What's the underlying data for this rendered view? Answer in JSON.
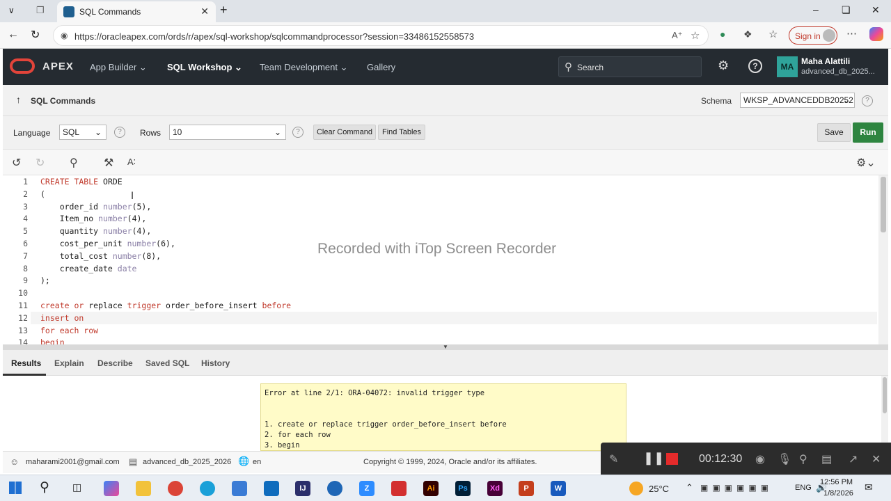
{
  "browser": {
    "tab_title": "SQL Commands",
    "url": "https://oracleapex.com/ords/r/apex/sql-workshop/sqlcommandprocessor?session=33486152558573",
    "signin_label": "Sign in"
  },
  "apex": {
    "brand": "APEX",
    "nav": [
      "App Builder",
      "SQL Workshop",
      "Team Development",
      "Gallery"
    ],
    "search_placeholder": "Search",
    "user_initials": "MA",
    "user_name": "Maha Alattili",
    "user_workspace": "advanced_db_2025..."
  },
  "page": {
    "title": "SQL Commands",
    "schema_label": "Schema",
    "schema_value": "WKSP_ADVANCEDDB20252"
  },
  "toolbar": {
    "language_label": "Language",
    "language_value": "SQL",
    "rows_label": "Rows",
    "rows_value": "10",
    "clear_label": "Clear Command",
    "find_label": "Find Tables",
    "save_label": "Save",
    "run_label": "Run"
  },
  "editor": {
    "lines": [
      {
        "n": "1",
        "parts": [
          {
            "t": "CREATE TABLE ",
            "c": "kw"
          },
          {
            "t": "ORDE",
            "c": ""
          }
        ]
      },
      {
        "n": "2",
        "parts": [
          {
            "t": "(",
            "c": ""
          }
        ]
      },
      {
        "n": "3",
        "parts": [
          {
            "t": "    order_id ",
            "c": ""
          },
          {
            "t": "number",
            "c": "ty"
          },
          {
            "t": "(5),",
            "c": ""
          }
        ]
      },
      {
        "n": "4",
        "parts": [
          {
            "t": "    Item_no ",
            "c": ""
          },
          {
            "t": "number",
            "c": "ty"
          },
          {
            "t": "(4),",
            "c": ""
          }
        ]
      },
      {
        "n": "5",
        "parts": [
          {
            "t": "    quantity ",
            "c": ""
          },
          {
            "t": "number",
            "c": "ty"
          },
          {
            "t": "(4),",
            "c": ""
          }
        ]
      },
      {
        "n": "6",
        "parts": [
          {
            "t": "    cost_per_unit ",
            "c": ""
          },
          {
            "t": "number",
            "c": "ty"
          },
          {
            "t": "(6),",
            "c": ""
          }
        ]
      },
      {
        "n": "7",
        "parts": [
          {
            "t": "    total_cost ",
            "c": ""
          },
          {
            "t": "number",
            "c": "ty"
          },
          {
            "t": "(8),",
            "c": ""
          }
        ]
      },
      {
        "n": "8",
        "parts": [
          {
            "t": "    create_date ",
            "c": ""
          },
          {
            "t": "date",
            "c": "ty"
          }
        ]
      },
      {
        "n": "9",
        "parts": [
          {
            "t": ");",
            "c": ""
          }
        ]
      },
      {
        "n": "10",
        "parts": []
      },
      {
        "n": "11",
        "parts": [
          {
            "t": "create ",
            "c": "kw"
          },
          {
            "t": "or ",
            "c": "kw"
          },
          {
            "t": "replace ",
            "c": ""
          },
          {
            "t": "trigger ",
            "c": "kw"
          },
          {
            "t": "order_before_insert ",
            "c": ""
          },
          {
            "t": "before",
            "c": "kw"
          }
        ]
      },
      {
        "n": "12",
        "parts": [
          {
            "t": "insert on",
            "c": "kw"
          }
        ]
      },
      {
        "n": "13",
        "parts": [
          {
            "t": "for each row",
            "c": "kw"
          }
        ]
      },
      {
        "n": "14",
        "parts": [
          {
            "t": "begin",
            "c": "kw"
          }
        ]
      }
    ],
    "watermark": "Recorded with iTop Screen Recorder"
  },
  "results": {
    "tabs": [
      "Results",
      "Explain",
      "Describe",
      "Saved SQL",
      "History"
    ],
    "error_title": "Error at line 2/1: ORA-04072: invalid trigger type",
    "error_lines": [
      "1. create or replace trigger order_before_insert before",
      "2. for each row",
      "3. begin"
    ]
  },
  "footer": {
    "email": "maharami2001@gmail.com",
    "workspace": "advanced_db_2025_2026",
    "lang": "en",
    "copyright": "Copyright © 1999, 2024, Oracle and/or its affiliates."
  },
  "recorder": {
    "time": "00:12:30"
  },
  "taskbar": {
    "temperature": "25°C",
    "lang": "ENG",
    "time": "12:56 PM",
    "date": "1/8/2026"
  }
}
